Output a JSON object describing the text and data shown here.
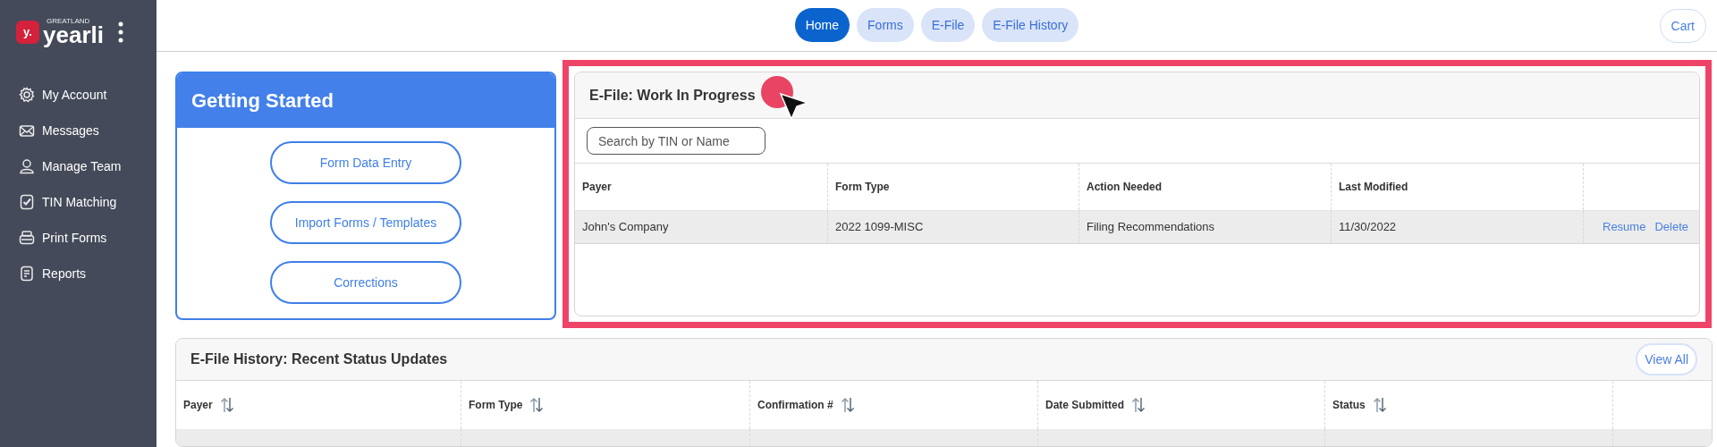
{
  "sidebar": {
    "logo_badge": "y.",
    "logo_small": "GREATLAND",
    "logo_text": "yearli",
    "items": [
      {
        "label": "My Account"
      },
      {
        "label": "Messages"
      },
      {
        "label": "Manage Team"
      },
      {
        "label": "TIN Matching"
      },
      {
        "label": "Print Forms"
      },
      {
        "label": "Reports"
      }
    ]
  },
  "top_nav": {
    "tabs": [
      {
        "label": "Home",
        "selected": true
      },
      {
        "label": "Forms",
        "selected": false
      },
      {
        "label": "E-File",
        "selected": false
      },
      {
        "label": "E-File History",
        "selected": false
      }
    ],
    "cart": "Cart"
  },
  "getting_started": {
    "title": "Getting Started",
    "buttons": [
      "Form Data Entry",
      "Import Forms / Templates",
      "Corrections"
    ]
  },
  "work_in_progress": {
    "title": "E-File: Work In Progress",
    "search": {
      "placeholder": "Search by TIN or Name"
    },
    "columns": [
      "Payer",
      "Form Type",
      "Action Needed",
      "Last Modified"
    ],
    "rows": [
      {
        "cells": [
          "John's Company",
          "2022 1099-MISC",
          "Filing Recommendations",
          "11/30/2022"
        ],
        "actions": [
          "Resume",
          "Delete"
        ]
      }
    ]
  },
  "history": {
    "title": "E-File History: Recent Status Updates",
    "view_all": "View All",
    "columns": [
      "Payer",
      "Form Type",
      "Confirmation #",
      "Date Submitted",
      "Status"
    ]
  }
}
